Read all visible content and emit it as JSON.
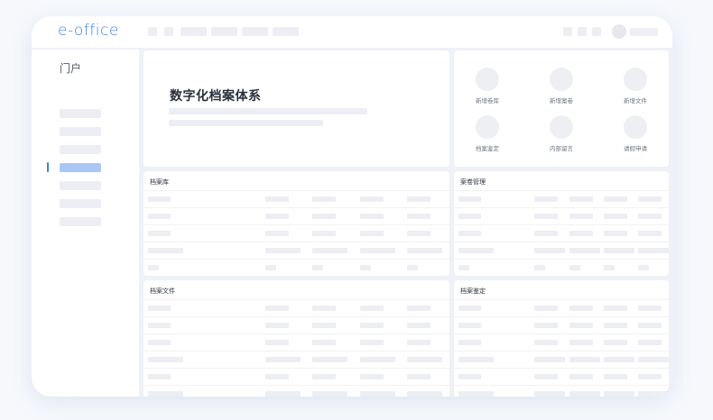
{
  "app": {
    "logo": "e-office"
  },
  "sidebar": {
    "title": "门户",
    "items": [
      {
        "id": "item-1",
        "active": false
      },
      {
        "id": "item-2",
        "active": false
      },
      {
        "id": "item-3",
        "active": false
      },
      {
        "id": "item-4",
        "active": true
      },
      {
        "id": "item-5",
        "active": false
      },
      {
        "id": "item-6",
        "active": false
      },
      {
        "id": "item-7",
        "active": false
      }
    ]
  },
  "hero": {
    "title": "数字化档案体系"
  },
  "quick_actions": [
    {
      "label": "新增卷库"
    },
    {
      "label": "新增案卷"
    },
    {
      "label": "新增文件"
    },
    {
      "label": "档案鉴定"
    },
    {
      "label": "内部留言"
    },
    {
      "label": "请假申请"
    }
  ],
  "panels": {
    "archive_library": {
      "title": "档案库"
    },
    "case_management": {
      "title": "案卷管理"
    },
    "archive_files": {
      "title": "档案文件"
    },
    "archive_appraisal": {
      "title": "档案鉴定"
    }
  },
  "colors": {
    "accent": "#3b82e8",
    "active_item": "#a9c6f4",
    "placeholder": "#eceef3"
  }
}
